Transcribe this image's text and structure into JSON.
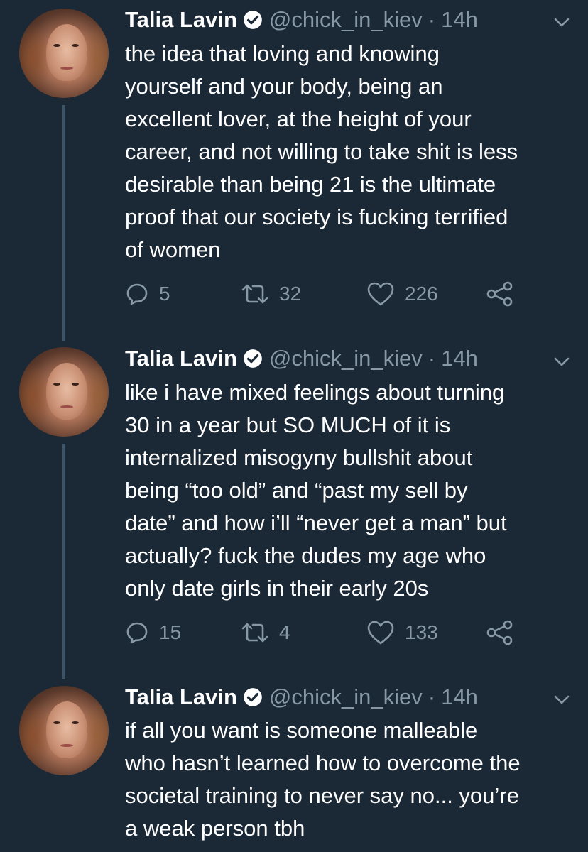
{
  "tweets": [
    {
      "name": "Talia Lavin",
      "handle": "@chick_in_kiev",
      "separator": "·",
      "time": "14h",
      "text": "the idea that loving and knowing\nyourself and your body, being an\nexcellent lover, at the height of your\ncareer, and not willing to take shit is less\ndesirable than being 21 is the ultimate\nproof that our society is fucking terrified\nof women",
      "replies": "5",
      "retweets": "32",
      "likes": "226"
    },
    {
      "name": "Talia Lavin",
      "handle": "@chick_in_kiev",
      "separator": "·",
      "time": "14h",
      "text": "like i have mixed feelings about turning\n30 in a year but SO MUCH of it is\ninternalized misogyny bullshit about\nbeing “too old” and “past my sell by\ndate” and how i’ll “never get a man” but\nactually? fuck the dudes my age who\nonly date girls in their early 20s",
      "replies": "15",
      "retweets": "4",
      "likes": "133"
    },
    {
      "name": "Talia Lavin",
      "handle": "@chick_in_kiev",
      "separator": "·",
      "time": "14h",
      "text": "if all you want is someone malleable\nwho hasn’t learned how to overcome the\nsocietal training to never say no... you’re\na weak person tbh"
    }
  ],
  "colors": {
    "background": "#1b2836",
    "secondary_text": "#8899a6",
    "thread_line": "#3d5466"
  },
  "icons": [
    "verified-badge-icon",
    "caret-down-icon",
    "reply-icon",
    "retweet-icon",
    "like-icon",
    "share-icon"
  ]
}
